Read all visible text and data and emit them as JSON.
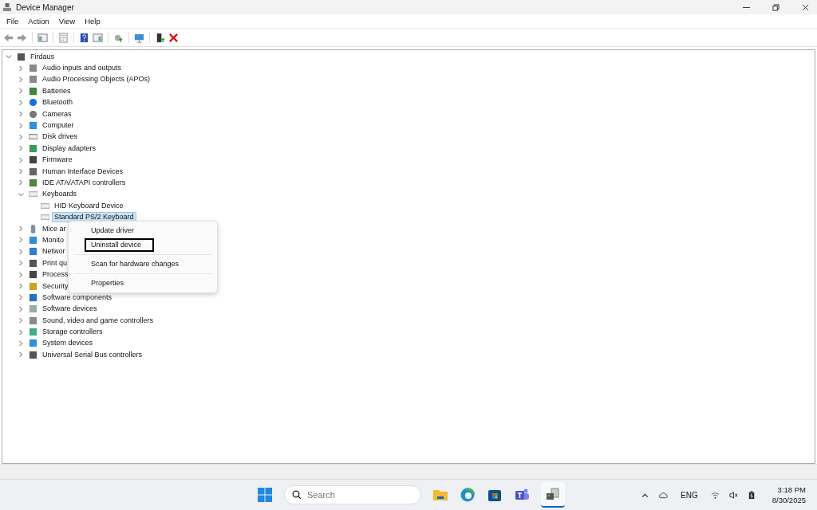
{
  "window": {
    "title": "Device Manager"
  },
  "menu": [
    "File",
    "Action",
    "View",
    "Help"
  ],
  "tree": {
    "label": "Firdaus",
    "expanded": true,
    "selected": false,
    "children": [
      {
        "label": "Audio inputs and outputs",
        "expanded": false,
        "selected": false
      },
      {
        "label": "Audio Processing Objects (APOs)",
        "expanded": false,
        "selected": false
      },
      {
        "label": "Batteries",
        "expanded": false,
        "selected": false
      },
      {
        "label": "Bluetooth",
        "expanded": false,
        "selected": false
      },
      {
        "label": "Cameras",
        "expanded": false,
        "selected": false
      },
      {
        "label": "Computer",
        "expanded": false,
        "selected": false
      },
      {
        "label": "Disk drives",
        "expanded": false,
        "selected": false
      },
      {
        "label": "Display adapters",
        "expanded": false,
        "selected": false
      },
      {
        "label": "Firmware",
        "expanded": false,
        "selected": false
      },
      {
        "label": "Human Interface Devices",
        "expanded": false,
        "selected": false
      },
      {
        "label": "IDE ATA/ATAPI controllers",
        "expanded": false,
        "selected": false
      },
      {
        "label": "Keyboards",
        "expanded": true,
        "selected": false,
        "children": [
          {
            "label": "HID Keyboard Device",
            "selected": false
          },
          {
            "label": "Standard PS/2 Keyboard",
            "selected": true
          }
        ]
      },
      {
        "label": "Mice ar",
        "expanded": false,
        "selected": false
      },
      {
        "label": "Monito",
        "expanded": false,
        "selected": false
      },
      {
        "label": "Networ",
        "expanded": false,
        "selected": false
      },
      {
        "label": "Print qu",
        "expanded": false,
        "selected": false
      },
      {
        "label": "Process",
        "expanded": false,
        "selected": false
      },
      {
        "label": "Security",
        "expanded": false,
        "selected": false
      },
      {
        "label": "Software components",
        "expanded": false,
        "selected": false
      },
      {
        "label": "Software devices",
        "expanded": false,
        "selected": false
      },
      {
        "label": "Sound, video and game controllers",
        "expanded": false,
        "selected": false
      },
      {
        "label": "Storage controllers",
        "expanded": false,
        "selected": false
      },
      {
        "label": "System devices",
        "expanded": false,
        "selected": false
      },
      {
        "label": "Universal Serial Bus controllers",
        "expanded": false,
        "selected": false
      }
    ]
  },
  "context_menu": [
    {
      "label": "Update driver",
      "outlined": false
    },
    {
      "label": "Uninstall device",
      "outlined": true
    },
    {
      "kind": "separator"
    },
    {
      "label": "Scan for hardware changes",
      "outlined": false
    },
    {
      "kind": "separator"
    },
    {
      "label": "Properties",
      "outlined": false
    }
  ],
  "taskbar": {
    "search": {
      "placeholder": "Search"
    },
    "language": "ENG",
    "time": "3:18 PM",
    "date": "8/30/2025"
  }
}
